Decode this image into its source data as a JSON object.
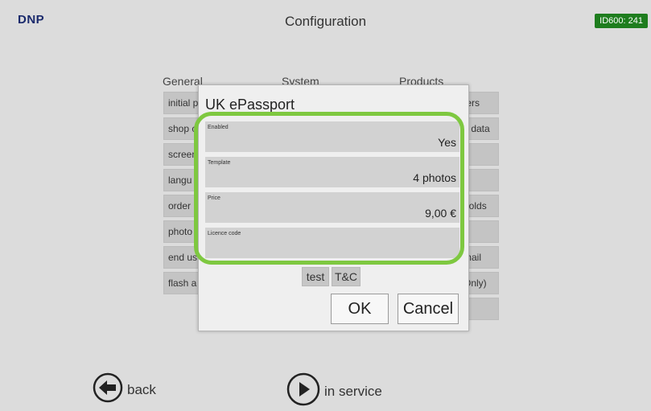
{
  "header": {
    "logo": "DNP",
    "title": "Configuration",
    "device_id": "ID600: 241"
  },
  "columns": {
    "general": "General",
    "system": "System",
    "products": "Products"
  },
  "background_buttons": {
    "general": [
      "initial p",
      "shop c",
      "screen",
      "langu",
      "order",
      "photo",
      "end us",
      "flash a"
    ],
    "products": [
      "ters",
      "s data",
      "",
      "",
      "holds",
      "",
      "mail",
      "Only)",
      ""
    ]
  },
  "dialog": {
    "title": "UK ePassport",
    "fields": [
      {
        "label": "Enabled",
        "value": "Yes"
      },
      {
        "label": "Template",
        "value": "4 photos"
      },
      {
        "label": "Price",
        "value": "9,00 €"
      },
      {
        "label": "Licence code",
        "value": ""
      }
    ],
    "test_label": "test",
    "tc_label": "T&C",
    "ok_label": "OK",
    "cancel_label": "Cancel"
  },
  "footer": {
    "back_label": "back",
    "in_service_label": "in service"
  },
  "colors": {
    "highlight": "#7ec840",
    "device_badge": "#1e7d1e",
    "logo": "#1a2a6c"
  }
}
